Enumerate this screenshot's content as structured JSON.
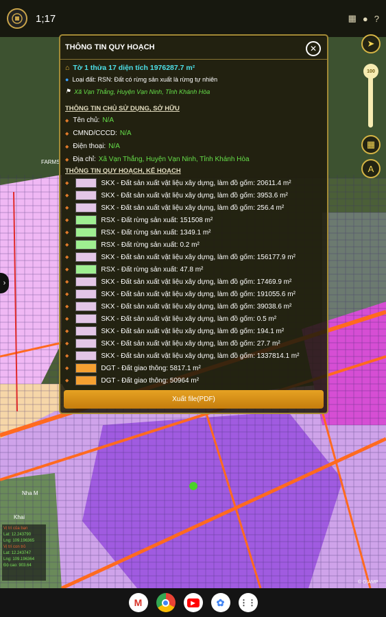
{
  "search": {
    "text": "1;17"
  },
  "panel": {
    "title": "THÔNG TIN QUY HOẠCH",
    "parcel_title": "Tờ 1 thửa 17 diện tích 1976287.7 m²",
    "land_type": "Loại đất: RSN: Đất có rừng sản xuất là rừng tự nhiên",
    "location": "Xã Vạn Thắng, Huyện Vạn Ninh, Tỉnh Khánh Hòa",
    "owner_section": "THÔNG TIN CHỦ SỬ DỤNG, SỞ HỮU",
    "owner_fields": [
      {
        "label": "Tên chủ:",
        "value": "N/A"
      },
      {
        "label": "CMND/CCCD:",
        "value": "N/A"
      },
      {
        "label": "Điện thoại:",
        "value": "N/A"
      },
      {
        "label": "Địa chỉ:",
        "value": "Xã Vạn Thắng, Huyện Vạn Ninh, Tỉnh Khánh Hòa"
      }
    ],
    "plan_section": "THÔNG TIN QUY HOẠCH, KẾ HOẠCH",
    "plan_items": [
      {
        "color": "#e3c6e6",
        "text": "SKX - Đất sản xuất vật liệu xây dựng, làm đồ gốm: 20611.4 m²"
      },
      {
        "color": "#e3c6e6",
        "text": "SKX - Đất sản xuất vật liệu xây dựng, làm đồ gốm: 3953.6 m²"
      },
      {
        "color": "#e3c6e6",
        "text": "SKX - Đất sản xuất vật liệu xây dựng, làm đồ gốm: 256.4 m²"
      },
      {
        "color": "#9fef91",
        "text": "RSX - Đất rừng sản xuất: 151508 m²"
      },
      {
        "color": "#9fef91",
        "text": "RSX - Đất rừng sản xuất: 1349.1 m²"
      },
      {
        "color": "#9fef91",
        "text": "RSX - Đất rừng sản xuất: 0.2 m²"
      },
      {
        "color": "#e3c6e6",
        "text": "SKX - Đất sản xuất vật liệu xây dựng, làm đồ gốm: 156177.9 m²"
      },
      {
        "color": "#9fef91",
        "text": "RSX - Đất rừng sản xuất: 47.8 m²"
      },
      {
        "color": "#e3c6e6",
        "text": "SKX - Đất sản xuất vật liệu xây dựng, làm đồ gốm: 17469.9 m²"
      },
      {
        "color": "#e3c6e6",
        "text": "SKX - Đất sản xuất vật liệu xây dựng, làm đồ gốm: 191055.6 m²"
      },
      {
        "color": "#e3c6e6",
        "text": "SKX - Đất sản xuất vật liệu xây dựng, làm đồ gốm: 39038.6 m²"
      },
      {
        "color": "#e3c6e6",
        "text": "SKX - Đất sản xuất vật liệu xây dựng, làm đồ gốm: 0.5 m²"
      },
      {
        "color": "#e3c6e6",
        "text": "SKX - Đất sản xuất vật liệu xây dựng, làm đồ gốm: 194.1 m²"
      },
      {
        "color": "#e3c6e6",
        "text": "SKX - Đất sản xuất vật liệu xây dựng, làm đồ gốm: 27.7 m²"
      },
      {
        "color": "#e3c6e6",
        "text": "SKX - Đất sản xuất vật liệu xây dựng, làm đồ gốm: 1337814.1 m²"
      },
      {
        "color": "#f5a031",
        "text": "DGT - Đất giao thông: 5817.1 m²"
      },
      {
        "color": "#f5a031",
        "text": "DGT - Đất giao thông: 50964 m²"
      }
    ],
    "pdf_button": "Xuất file(PDF)"
  },
  "map_controls": {
    "zoom_label": "100"
  },
  "map_labels": {
    "farm": "FARMS",
    "district": "Nha M",
    "corner": "Khai",
    "credit": "© GIAMP"
  },
  "location_box": {
    "title": "Vị trí của bạn",
    "lat1": "Lat: 12.243790",
    "lng1": "Lng: 109.196365",
    "title2": "Vị trí con trỏ",
    "lat2": "Lat: 12.243747",
    "lng2": "Lng: 109.196364",
    "acc": "Độ cao: 903.64"
  },
  "colors": {
    "accent": "#d6b545",
    "panel_border": "#a38a36",
    "skx": "#e3c6e6",
    "rsx": "#9fef91",
    "dgt": "#f5a031"
  },
  "apps": [
    "gmail",
    "chrome",
    "youtube",
    "photos",
    "app-drawer"
  ]
}
